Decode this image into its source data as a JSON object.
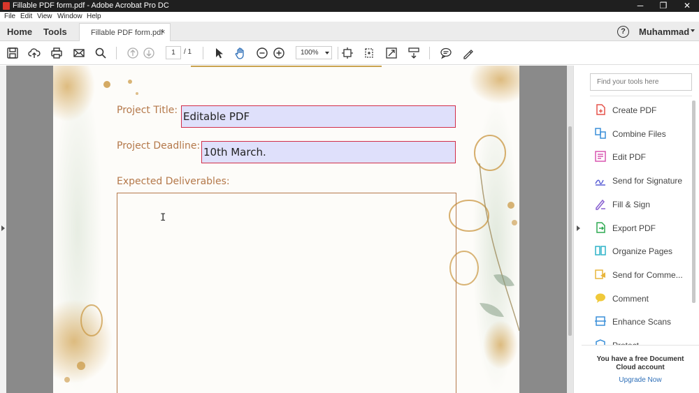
{
  "titlebar": {
    "title": "Fillable PDF form.pdf - Adobe Acrobat Pro DC",
    "minimize": "─",
    "maximize": "❐",
    "close": "✕"
  },
  "menu": {
    "file": "File",
    "edit": "Edit",
    "view": "View",
    "window": "Window",
    "help": "Help"
  },
  "tabs": {
    "home": "Home",
    "tools": "Tools",
    "doc_tab": "Fillable PDF form.pdf",
    "close": "×"
  },
  "header": {
    "help": "?",
    "user": "Muhammad"
  },
  "toolbar": {
    "page_current": "1",
    "page_total": "/ 1",
    "zoom": "100%",
    "icons": [
      "save-icon",
      "cloud-upload-icon",
      "print-icon",
      "email-icon",
      "search-icon",
      "prev-page-icon",
      "next-page-icon",
      "select-arrow-icon",
      "hand-tool-icon",
      "zoom-out-icon",
      "zoom-in-icon",
      "fit-page-icon",
      "rotate-icon",
      "full-screen-icon",
      "scroll-mode-icon",
      "comment-icon",
      "highlight-pen-icon"
    ]
  },
  "form": {
    "project_title_label": "Project Title:",
    "project_title_value": "Editable PDF",
    "project_deadline_label": "Project Deadline:",
    "project_deadline_value": "10th March.",
    "deliverables_label": "Expected Deliverables:",
    "cursor": "I"
  },
  "right_pane": {
    "search_placeholder": "Find your tools here",
    "tools": [
      {
        "label": "Create PDF",
        "icon": "create-pdf-icon",
        "color": "#e5534b"
      },
      {
        "label": "Combine Files",
        "icon": "combine-files-icon",
        "color": "#3a8fd9"
      },
      {
        "label": "Edit PDF",
        "icon": "edit-pdf-icon",
        "color": "#d957b0"
      },
      {
        "label": "Send for Signature",
        "icon": "send-signature-icon",
        "color": "#5a5fd6"
      },
      {
        "label": "Fill & Sign",
        "icon": "fill-sign-icon",
        "color": "#8860d0"
      },
      {
        "label": "Export PDF",
        "icon": "export-pdf-icon",
        "color": "#2eaa52"
      },
      {
        "label": "Organize Pages",
        "icon": "organize-pages-icon",
        "color": "#2fb3c9"
      },
      {
        "label": "Send for Comme...",
        "icon": "send-comments-icon",
        "color": "#e8b53c"
      },
      {
        "label": "Comment",
        "icon": "comment-tool-icon",
        "color": "#f0c93a"
      },
      {
        "label": "Enhance Scans",
        "icon": "enhance-scans-icon",
        "color": "#3a8fd9"
      },
      {
        "label": "Protect",
        "icon": "protect-icon",
        "color": "#3a8fd9"
      }
    ],
    "promo_line1": "You have a free Document",
    "promo_line2": "Cloud account",
    "promo_link": "Upgrade Now"
  },
  "colors": {
    "accent_red": "#d12e4a",
    "field_fill": "#dfe0fb",
    "label_brown": "#b4784a",
    "link_blue": "#2e6fb8"
  }
}
